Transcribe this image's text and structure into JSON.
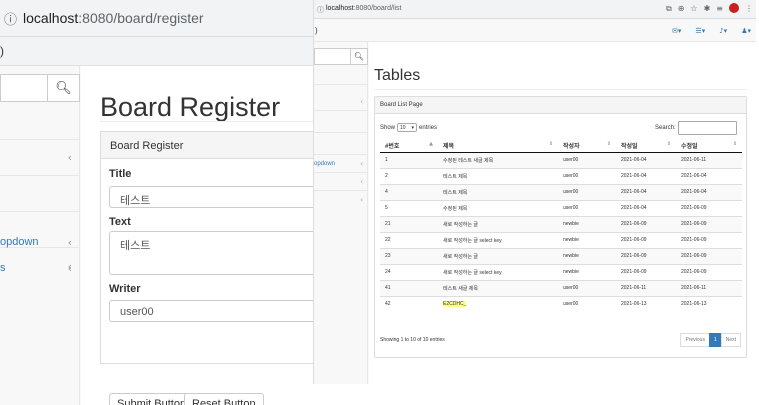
{
  "left_window": {
    "url_host": "localhost",
    "url_rest": ":8080/board/register",
    "tab_fragment": ")",
    "sidebar": {
      "items": [
        {
          "label": "",
          "has_chevron": false
        },
        {
          "label": "",
          "has_chevron": true
        },
        {
          "label": "",
          "has_chevron": false
        },
        {
          "label": "",
          "has_chevron": false
        },
        {
          "label": "",
          "has_chevron": true
        },
        {
          "label": "opdown",
          "has_chevron": true
        },
        {
          "label": "s",
          "has_chevron": true
        }
      ]
    },
    "page_title": "Board Register",
    "panel_heading": "Board Register",
    "form": {
      "title_label": "Title",
      "title_value": "테스트",
      "text_label": "Text",
      "text_value": "테스트",
      "writer_label": "Writer",
      "writer_value": "user00"
    },
    "buttons": {
      "submit": "Submit Button",
      "reset": "Reset Button"
    }
  },
  "right_window": {
    "url_host": "localhost",
    "url_rest": ":8080/board/list",
    "tab_fragment": ")",
    "page_title": "Tables",
    "panel_heading": "Board List Page",
    "show_label": "Show",
    "show_value": "10",
    "entries_label": "entries",
    "search_label": "Search:",
    "columns": [
      "#번호",
      "제목",
      "작성자",
      "작성일",
      "수정일"
    ],
    "rows": [
      [
        "1",
        "수정된 테스트 새글 제목",
        "user00",
        "2021-06-04",
        "2021-06-11"
      ],
      [
        "2",
        "테스트 제목",
        "user00",
        "2021-06-04",
        "2021-06-04"
      ],
      [
        "4",
        "테스트 제목",
        "user00",
        "2021-06-04",
        "2021-06-04"
      ],
      [
        "5",
        "수정된 제목",
        "user00",
        "2021-06-04",
        "2021-06-09"
      ],
      [
        "21",
        "새로 작성하는 글",
        "newbie",
        "2021-06-09",
        "2021-06-09"
      ],
      [
        "22",
        "새로 작성하는 글 select key",
        "newbie",
        "2021-06-09",
        "2021-06-09"
      ],
      [
        "23",
        "새로 작성하는 글",
        "newbie",
        "2021-06-09",
        "2021-06-09"
      ],
      [
        "24",
        "새로 작성하는 글 select key",
        "newbie",
        "2021-06-09",
        "2021-06-09"
      ],
      [
        "41",
        "테스트 새글 제목",
        "user00",
        "2021-06-11",
        "2021-06-11"
      ],
      [
        "42",
        "E2CDHC_",
        "user00",
        "2021-06-13",
        "2021-06-13"
      ]
    ],
    "info_text": "Showing 1 to 10 of 10 entries",
    "pager": {
      "prev": "Previous",
      "current": "1",
      "next": "Next"
    },
    "sidebar_items": [
      "",
      "",
      "",
      "",
      "opdown",
      ""
    ]
  }
}
